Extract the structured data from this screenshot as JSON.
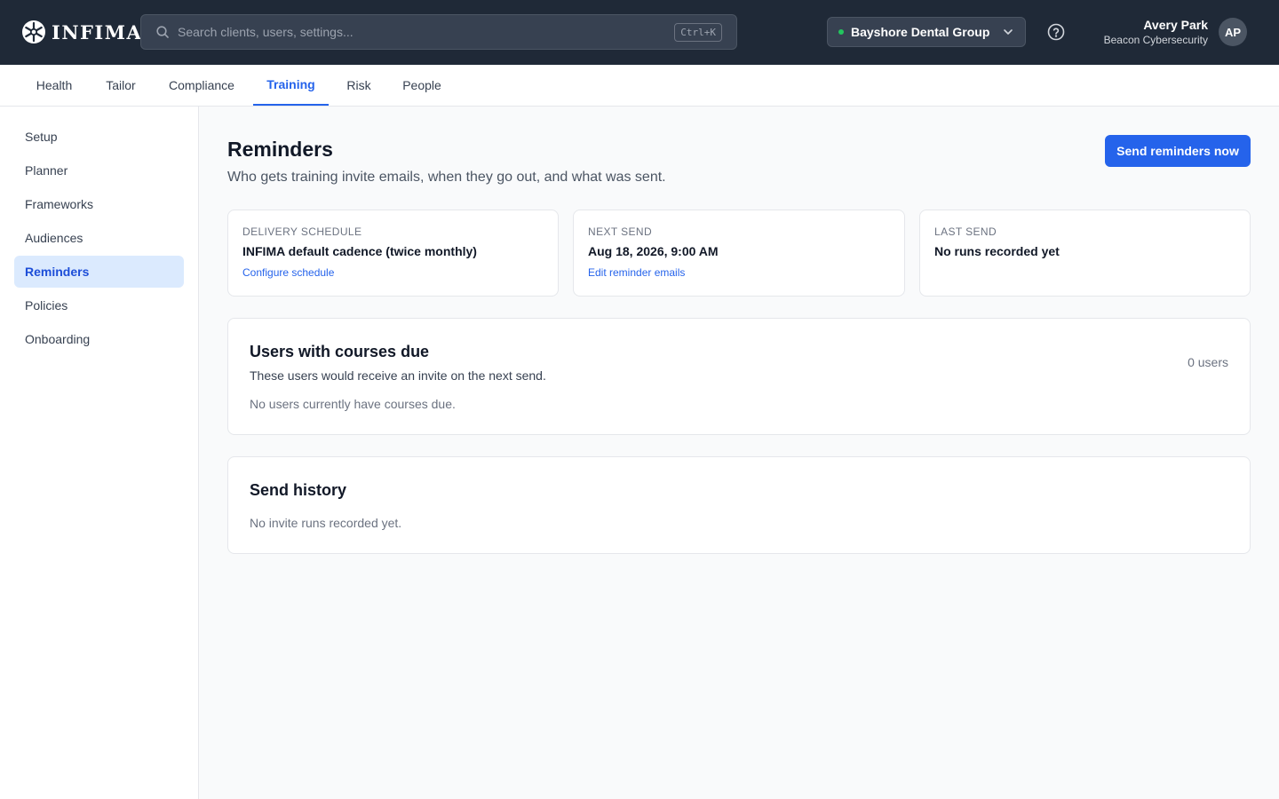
{
  "app": {
    "logo_text": "INFIMA"
  },
  "search": {
    "placeholder": "Search clients, users, settings...",
    "shortcut": "Ctrl+K"
  },
  "client_selector": {
    "name": "Bayshore Dental Group",
    "status_color": "#22c55e"
  },
  "user": {
    "name": "Avery Park",
    "org": "Beacon Cybersecurity",
    "initials": "AP"
  },
  "tabs": [
    {
      "label": "Health"
    },
    {
      "label": "Tailor"
    },
    {
      "label": "Compliance"
    },
    {
      "label": "Training",
      "active": true
    },
    {
      "label": "Risk"
    },
    {
      "label": "People"
    }
  ],
  "sidebar": {
    "items": [
      {
        "label": "Setup"
      },
      {
        "label": "Planner"
      },
      {
        "label": "Frameworks"
      },
      {
        "label": "Audiences"
      },
      {
        "label": "Reminders",
        "active": true
      },
      {
        "label": "Policies"
      },
      {
        "label": "Onboarding"
      }
    ]
  },
  "page": {
    "title": "Reminders",
    "subtitle": "Who gets training invite emails, when they go out, and what was sent.",
    "primary_action": "Send reminders now"
  },
  "stats": [
    {
      "label": "Delivery schedule",
      "value": "INFIMA default cadence (twice monthly)",
      "link": "Configure schedule"
    },
    {
      "label": "Next send",
      "value": "Aug 18, 2026, 9:00 AM",
      "link": "Edit reminder emails"
    },
    {
      "label": "Last send",
      "value": "No runs recorded yet"
    }
  ],
  "due_users": {
    "title": "Users with courses due",
    "subtitle": "These users would receive an invite on the next send.",
    "count": "0 users",
    "empty": "No users currently have courses due."
  },
  "history": {
    "title": "Send history",
    "empty": "No invite runs recorded yet."
  },
  "colors": {
    "accent": "#2563eb",
    "topbar": "#1f2937",
    "active_bg": "#dbeafe"
  }
}
